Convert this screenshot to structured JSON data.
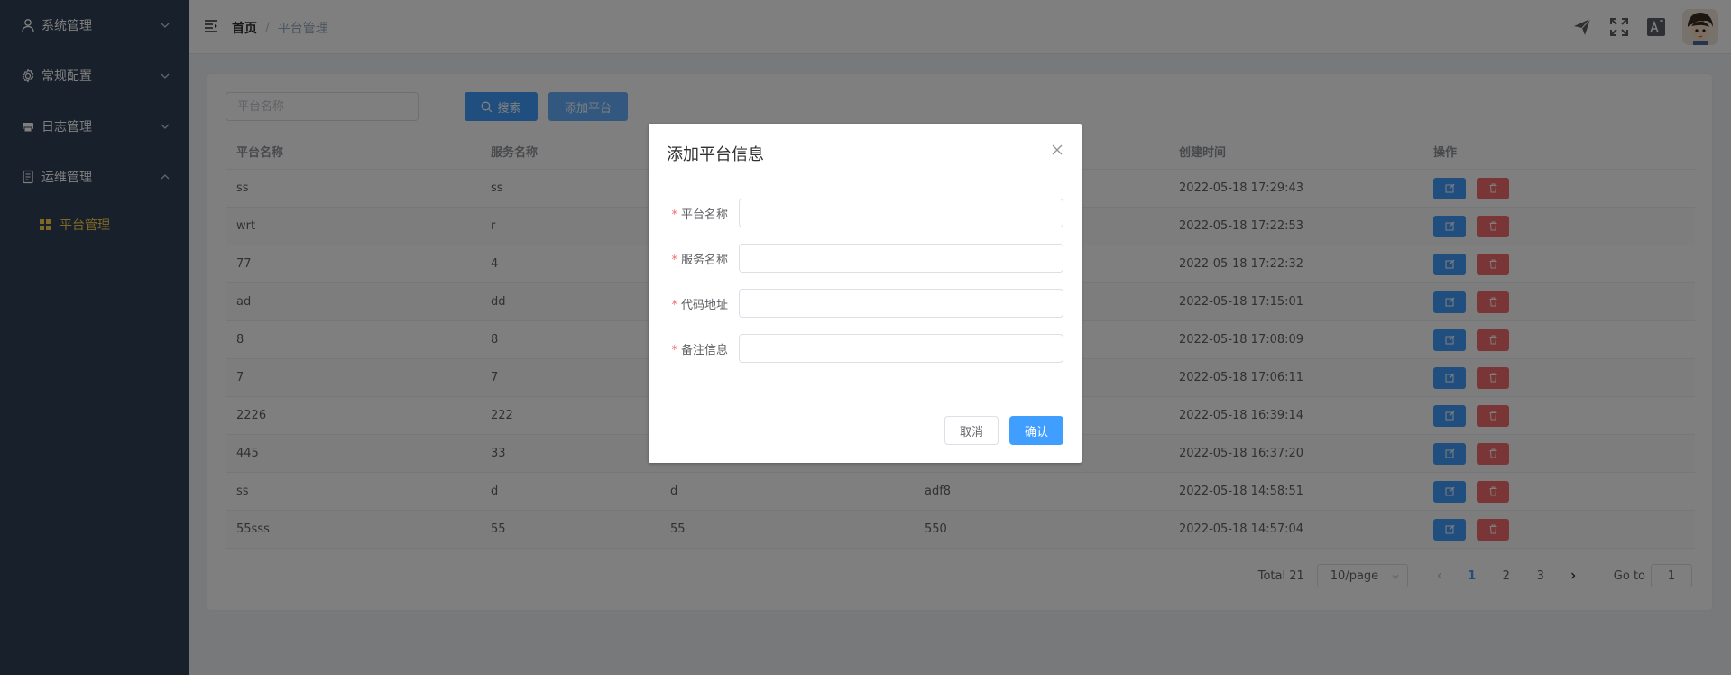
{
  "sidebar": {
    "items": [
      {
        "label": "系统管理",
        "icon": "user-icon",
        "expanded": false
      },
      {
        "label": "常规配置",
        "icon": "gear-icon",
        "expanded": false
      },
      {
        "label": "日志管理",
        "icon": "printer-icon",
        "expanded": false
      },
      {
        "label": "运维管理",
        "icon": "document-icon",
        "expanded": true
      }
    ],
    "sub_items": [
      {
        "label": "平台管理",
        "icon": "grid-icon",
        "active": true
      }
    ]
  },
  "header": {
    "breadcrumb": {
      "home": "首页",
      "separator": "/",
      "current": "平台管理"
    },
    "icons": [
      "send-icon",
      "fullscreen-icon",
      "translate-icon",
      "avatar"
    ]
  },
  "toolbar": {
    "search_placeholder": "平台名称",
    "search_label": "搜索",
    "add_label": "添加平台"
  },
  "table": {
    "columns": [
      "平台名称",
      "服务名称",
      "",
      "",
      "创建时间",
      "操作"
    ],
    "rows": [
      [
        "ss",
        "ss",
        "",
        "",
        "2022-05-18 17:29:43"
      ],
      [
        "wrt",
        "r",
        "",
        "",
        "2022-05-18 17:22:53"
      ],
      [
        "77",
        "4",
        "",
        "",
        "2022-05-18 17:22:32"
      ],
      [
        "ad",
        "dd",
        "",
        "",
        "2022-05-18 17:15:01"
      ],
      [
        "8",
        "8",
        "",
        "",
        "2022-05-18 17:08:09"
      ],
      [
        "7",
        "7",
        "",
        "",
        "2022-05-18 17:06:11"
      ],
      [
        "2226",
        "222",
        "",
        "",
        "2022-05-18 16:39:14"
      ],
      [
        "445",
        "33",
        "",
        "",
        "2022-05-18 16:37:20"
      ],
      [
        "ss",
        "d",
        "d",
        "adf8",
        "2022-05-18 14:58:51"
      ],
      [
        "55sss",
        "55",
        "55",
        "550",
        "2022-05-18 14:57:04"
      ]
    ]
  },
  "pagination": {
    "total": "Total 21",
    "page_size": "10/page",
    "pages": [
      "1",
      "2",
      "3"
    ],
    "current_page": "1",
    "goto_label": "Go to",
    "goto_value": "1"
  },
  "dialog": {
    "title": "添加平台信息",
    "fields": [
      {
        "label": "平台名称",
        "required": "*",
        "value": ""
      },
      {
        "label": "服务名称",
        "required": "*",
        "value": ""
      },
      {
        "label": "代码地址",
        "required": "*",
        "value": ""
      },
      {
        "label": "备注信息",
        "required": "*",
        "value": ""
      }
    ],
    "cancel_label": "取消",
    "confirm_label": "确认"
  },
  "colors": {
    "sidebar_bg": "#304156",
    "active_menu": "#ffd04b",
    "primary": "#409eff",
    "danger": "#f56c6c"
  }
}
